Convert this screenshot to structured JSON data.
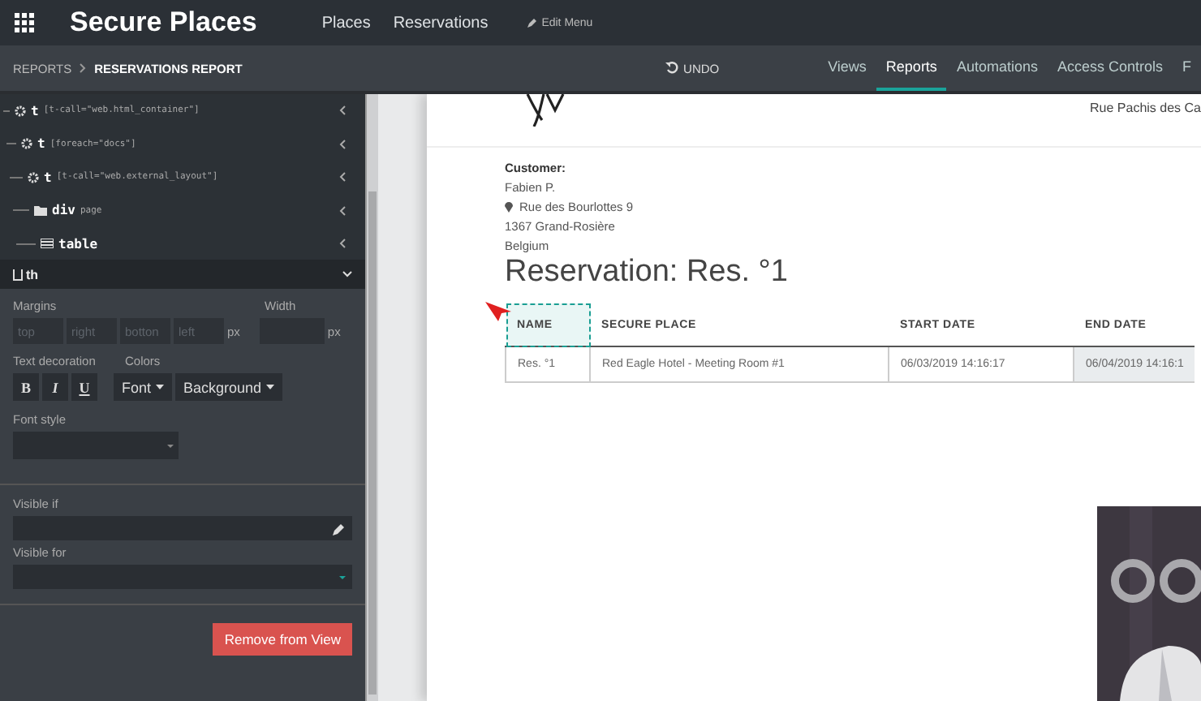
{
  "app_bar": {
    "title": "Secure Places",
    "menu": [
      {
        "label": "Places"
      },
      {
        "label": "Reservations"
      }
    ],
    "edit_menu": "Edit Menu"
  },
  "breadcrumb": [
    "REPORTS",
    "RESERVATIONS REPORT"
  ],
  "undo": "UNDO",
  "tabs": [
    {
      "label": "Views",
      "selected": false
    },
    {
      "label": "Reports",
      "selected": true
    },
    {
      "label": "Automations",
      "selected": false
    },
    {
      "label": "Access Controls",
      "selected": false
    },
    {
      "label": "F",
      "selected": false
    }
  ],
  "tree": [
    {
      "kind": "template",
      "tag": "t",
      "attr": "[t-call=\"web.html_container\"]",
      "children": [
        {
          "kind": "template",
          "tag": "t",
          "attr": "[foreach=\"docs\"]",
          "children": [
            {
              "kind": "template",
              "tag": "t",
              "attr": "[t-call=\"web.external_layout\"]",
              "children": [
                {
                  "kind": "folder",
                  "tag": "div",
                  "attr": "page",
                  "children": [
                    {
                      "kind": "table",
                      "tag": "table"
                    }
                  ]
                }
              ]
            }
          ]
        }
      ]
    }
  ],
  "section": {
    "title": "th",
    "expanded": true
  },
  "form": {
    "margins_label": "Margins",
    "margin_placeholders": [
      "top",
      "right",
      "botton",
      "left"
    ],
    "unit": "px",
    "width_label": "Width",
    "width_unit": "px",
    "text_decoration_label": "Text decoration",
    "decorations": [
      "B",
      "I",
      "U"
    ],
    "colors_label": "Colors",
    "color_buttons": [
      "Font",
      "Background"
    ],
    "font_style_label": "Font style",
    "visible_if_label": "Visible if",
    "visible_for_label": "Visible for",
    "remove_button": "Remove from View"
  },
  "document": {
    "header_address": "Rue Pachis des Ca",
    "customer_label": "Customer:",
    "customer_name": "Fabien P.",
    "address_lines": [
      "Rue des Bourlottes 9",
      "1367 Grand-Rosière",
      "Belgium"
    ],
    "title": "Reservation: Res. °1",
    "table": {
      "columns": [
        {
          "label": "NAME",
          "selected": true
        },
        {
          "label": "SECURE PLACE",
          "selected": false
        },
        {
          "label": "START DATE",
          "selected": false
        },
        {
          "label": "END DATE",
          "selected": false
        }
      ],
      "rows": [
        [
          "Res. °1",
          "Red Eagle Hotel - Meeting Room #1",
          "06/03/2019 14:16:17",
          "06/04/2019 14:16:1"
        ]
      ]
    }
  },
  "webcam": {
    "kind": "picture"
  }
}
